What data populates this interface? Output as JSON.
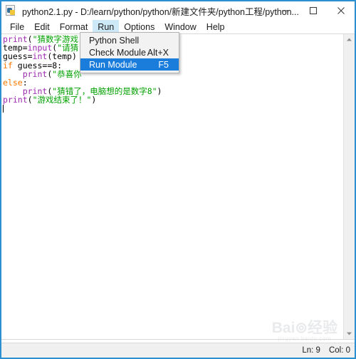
{
  "window": {
    "title": "python2.1.py - D:/learn/python/python/新建文件夹/python工程/python...",
    "icon": "python-file-icon",
    "border_color": "#2b8fd0",
    "controls": {
      "minimize": "minimize-icon",
      "maximize": "maximize-icon",
      "close": "close-icon"
    }
  },
  "menubar": {
    "items": [
      {
        "label": "File",
        "active": false
      },
      {
        "label": "Edit",
        "active": false
      },
      {
        "label": "Format",
        "active": false
      },
      {
        "label": "Run",
        "active": true
      },
      {
        "label": "Options",
        "active": false
      },
      {
        "label": "Window",
        "active": false
      },
      {
        "label": "Help",
        "active": false
      }
    ],
    "active_highlight_color": "#cde8f7"
  },
  "run_menu": {
    "open": true,
    "selected_color": "#1a7ddb",
    "items": [
      {
        "label": "Python Shell",
        "accel": "",
        "selected": false
      },
      {
        "label": "Check Module",
        "accel": "Alt+X",
        "selected": false
      },
      {
        "label": "Run Module",
        "accel": "F5",
        "selected": true
      }
    ]
  },
  "editor": {
    "syntax_colors": {
      "keyword": "#ff7700",
      "builtin": "#9c27b0",
      "string": "#00a000",
      "plain": "#000000"
    },
    "lines": [
      [
        {
          "t": "print",
          "c": "builtin"
        },
        {
          "t": "(",
          "c": "plain"
        },
        {
          "t": "\"猜数字游戏",
          "c": "str"
        }
      ],
      [
        {
          "t": "temp=",
          "c": "plain"
        },
        {
          "t": "input",
          "c": "builtin"
        },
        {
          "t": "(",
          "c": "plain"
        },
        {
          "t": "\"请猜-",
          "c": "str"
        }
      ],
      [
        {
          "t": "guess=",
          "c": "plain"
        },
        {
          "t": "int",
          "c": "builtin"
        },
        {
          "t": "(temp)",
          "c": "plain"
        }
      ],
      [
        {
          "t": "if",
          "c": "kw"
        },
        {
          "t": " guess==8:",
          "c": "plain"
        }
      ],
      [
        {
          "t": "    ",
          "c": "plain"
        },
        {
          "t": "print",
          "c": "builtin"
        },
        {
          "t": "(",
          "c": "plain"
        },
        {
          "t": "\"恭喜你",
          "c": "str"
        }
      ],
      [
        {
          "t": "else",
          "c": "kw"
        },
        {
          "t": ":",
          "c": "plain"
        }
      ],
      [
        {
          "t": "    ",
          "c": "plain"
        },
        {
          "t": "print",
          "c": "builtin"
        },
        {
          "t": "(",
          "c": "plain"
        },
        {
          "t": "\"猜错了，电脑想的是数字8\"",
          "c": "str"
        },
        {
          "t": ")",
          "c": "plain"
        }
      ],
      [
        {
          "t": "print",
          "c": "builtin"
        },
        {
          "t": "(",
          "c": "plain"
        },
        {
          "t": "\"游戏结束了！\"",
          "c": "str"
        },
        {
          "t": ")",
          "c": "plain"
        }
      ],
      []
    ]
  },
  "scrollbar": {
    "up_arrow": "chevron-up-icon",
    "down_arrow": "chevron-down-icon"
  },
  "statusbar": {
    "line": "Ln: 9",
    "column": "Col: 0"
  },
  "watermark": {
    "main": "Bai⊚经验",
    "sub": "jingyan.baidu.com"
  }
}
